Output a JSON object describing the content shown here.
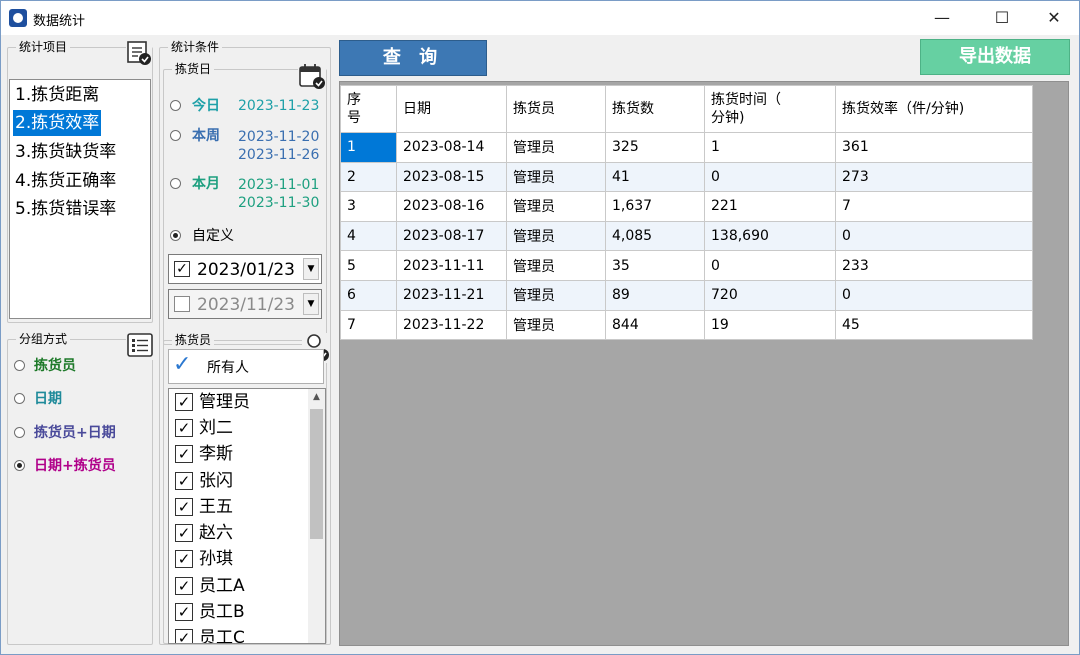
{
  "window": {
    "title": "数据统计",
    "minimize": "—",
    "maximize": "☐",
    "close": "✕"
  },
  "stat_items": {
    "title": "统计项目",
    "icon": "checklist-icon",
    "items": [
      "1.拣货距离",
      "2.拣货效率",
      "3.拣货缺货率",
      "4.拣货正确率",
      "5.拣货错误率"
    ],
    "selected_index": 1
  },
  "conditions": {
    "title": "统计条件",
    "pick_date": {
      "title": "拣货日",
      "icon": "calendar-check-icon",
      "today": {
        "label": "今日",
        "date": "2023-11-23",
        "color": "#1ea0a8"
      },
      "this_week": {
        "label": "本周",
        "date_from": "2023-11-20",
        "date_to": "2023-11-26",
        "color": "#3a6fb0"
      },
      "this_month": {
        "label": "本月",
        "date_from": "2023-11-01",
        "date_to": "2023-11-30",
        "color": "#1ea080"
      },
      "custom": {
        "label": "自定义",
        "checked": true
      },
      "start_date": {
        "value": "2023/01/23",
        "checked": true
      },
      "end_date": {
        "value": "2023/11/23",
        "checked": false
      }
    },
    "picker": {
      "title": "拣货员",
      "icon": "user-check-icon",
      "all_label": "所有人",
      "all_check": "✓",
      "people": [
        "管理员",
        "刘二",
        "李斯",
        "张闪",
        "王五",
        "赵六",
        "孙琪",
        "员工A",
        "员工B",
        "员工C"
      ]
    }
  },
  "group_by": {
    "title": "分组方式",
    "icon": "list-icon",
    "options": [
      {
        "label": "拣货员",
        "color": "#1e7a2a"
      },
      {
        "label": "日期",
        "color": "#1e8a9a"
      },
      {
        "label": "拣货员+日期",
        "color": "#4a4a9a"
      },
      {
        "label": "日期+拣货员",
        "color": "#b0008a"
      }
    ],
    "selected_index": 3
  },
  "toolbar": {
    "query_label": "查 询",
    "export_label": "导出数据"
  },
  "table": {
    "headers": [
      "序\n号",
      "日期",
      "拣货员",
      "拣货数",
      "拣货时间（\n分钟)",
      "拣货效率（件/分钟)"
    ],
    "rows": [
      [
        "1",
        "2023-08-14",
        "管理员",
        "325",
        "1",
        "361"
      ],
      [
        "2",
        "2023-08-15",
        "管理员",
        "41",
        "0",
        "273"
      ],
      [
        "3",
        "2023-08-16",
        "管理员",
        "1,637",
        "221",
        "7"
      ],
      [
        "4",
        "2023-08-17",
        "管理员",
        "4,085",
        "138,690",
        "0"
      ],
      [
        "5",
        "2023-11-11",
        "管理员",
        "35",
        "0",
        "233"
      ],
      [
        "6",
        "2023-11-21",
        "管理员",
        "89",
        "720",
        "0"
      ],
      [
        "7",
        "2023-11-22",
        "管理员",
        "844",
        "19",
        "45"
      ]
    ]
  }
}
